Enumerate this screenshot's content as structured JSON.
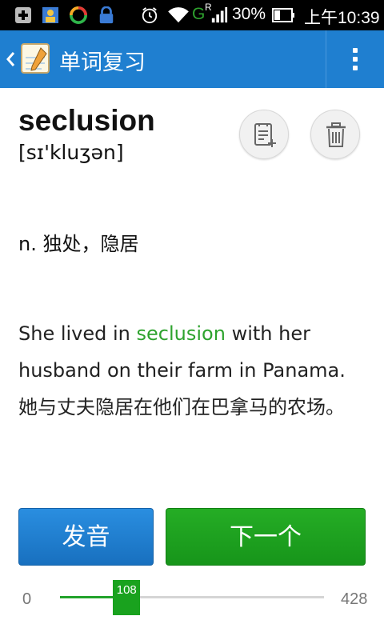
{
  "status_bar": {
    "battery_percent": "30%",
    "time": "上午10:39",
    "network_letter": "G",
    "network_sup": "R"
  },
  "app_bar": {
    "title": "单词复习",
    "app_icon_text": "Words"
  },
  "card": {
    "word": "seclusion",
    "phonetic": "[sɪ'kluʒən]",
    "definition": "n. 独处，隐居",
    "example_before": "She lived in ",
    "example_highlight": "seclusion",
    "example_after": " with her husband on their farm in Panama.",
    "translation": "她与丈夫隐居在他们在巴拿马的农场。"
  },
  "buttons": {
    "pronounce": "发音",
    "next": "下一个"
  },
  "progress": {
    "min": "0",
    "max": "428",
    "current": "108",
    "current_value": 108,
    "max_value": 428
  },
  "colors": {
    "app_bar": "#1f7fd0",
    "accent_green": "#2ea32e",
    "button_blue": "#1f80d0",
    "button_green": "#1ea21f"
  }
}
